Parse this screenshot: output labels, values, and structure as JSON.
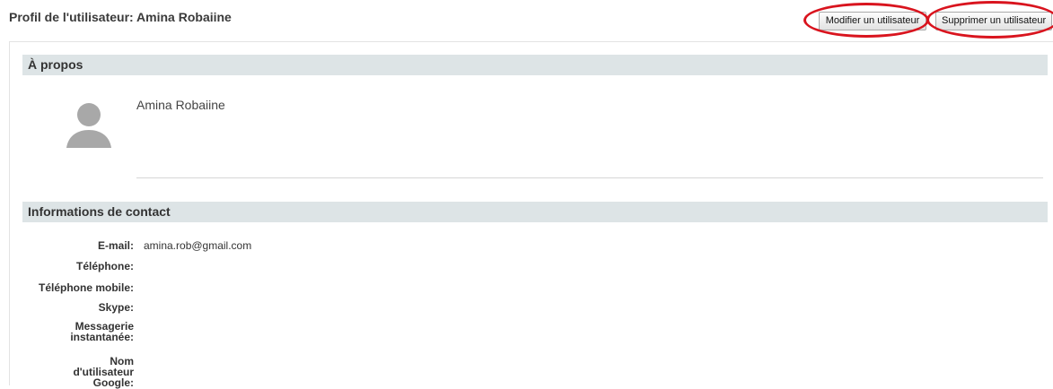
{
  "header": {
    "title": "Profil de l'utilisateur: Amina Robaiine",
    "edit_button": "Modifier un utilisateur",
    "delete_button": "Supprimer un utilisateur"
  },
  "about": {
    "heading": "À propos",
    "name": "Amina Robaiine",
    "avatar_icon": "user-silhouette-icon"
  },
  "contact": {
    "heading": "Informations de contact",
    "fields": [
      {
        "label": "E-mail:",
        "value": "amina.rob@gmail.com"
      },
      {
        "label": "Téléphone:",
        "value": ""
      },
      {
        "label": "Téléphone mobile:",
        "value": ""
      },
      {
        "label": "Skype:",
        "value": ""
      },
      {
        "label": "Messagerie instantanée:",
        "value": ""
      },
      {
        "label": "Nom d'utilisateur Google:",
        "value": ""
      }
    ]
  },
  "colors": {
    "section_header_bg": "#dde4e6",
    "annotation_oval": "#d9141e",
    "avatar": "#a8a8a8"
  }
}
